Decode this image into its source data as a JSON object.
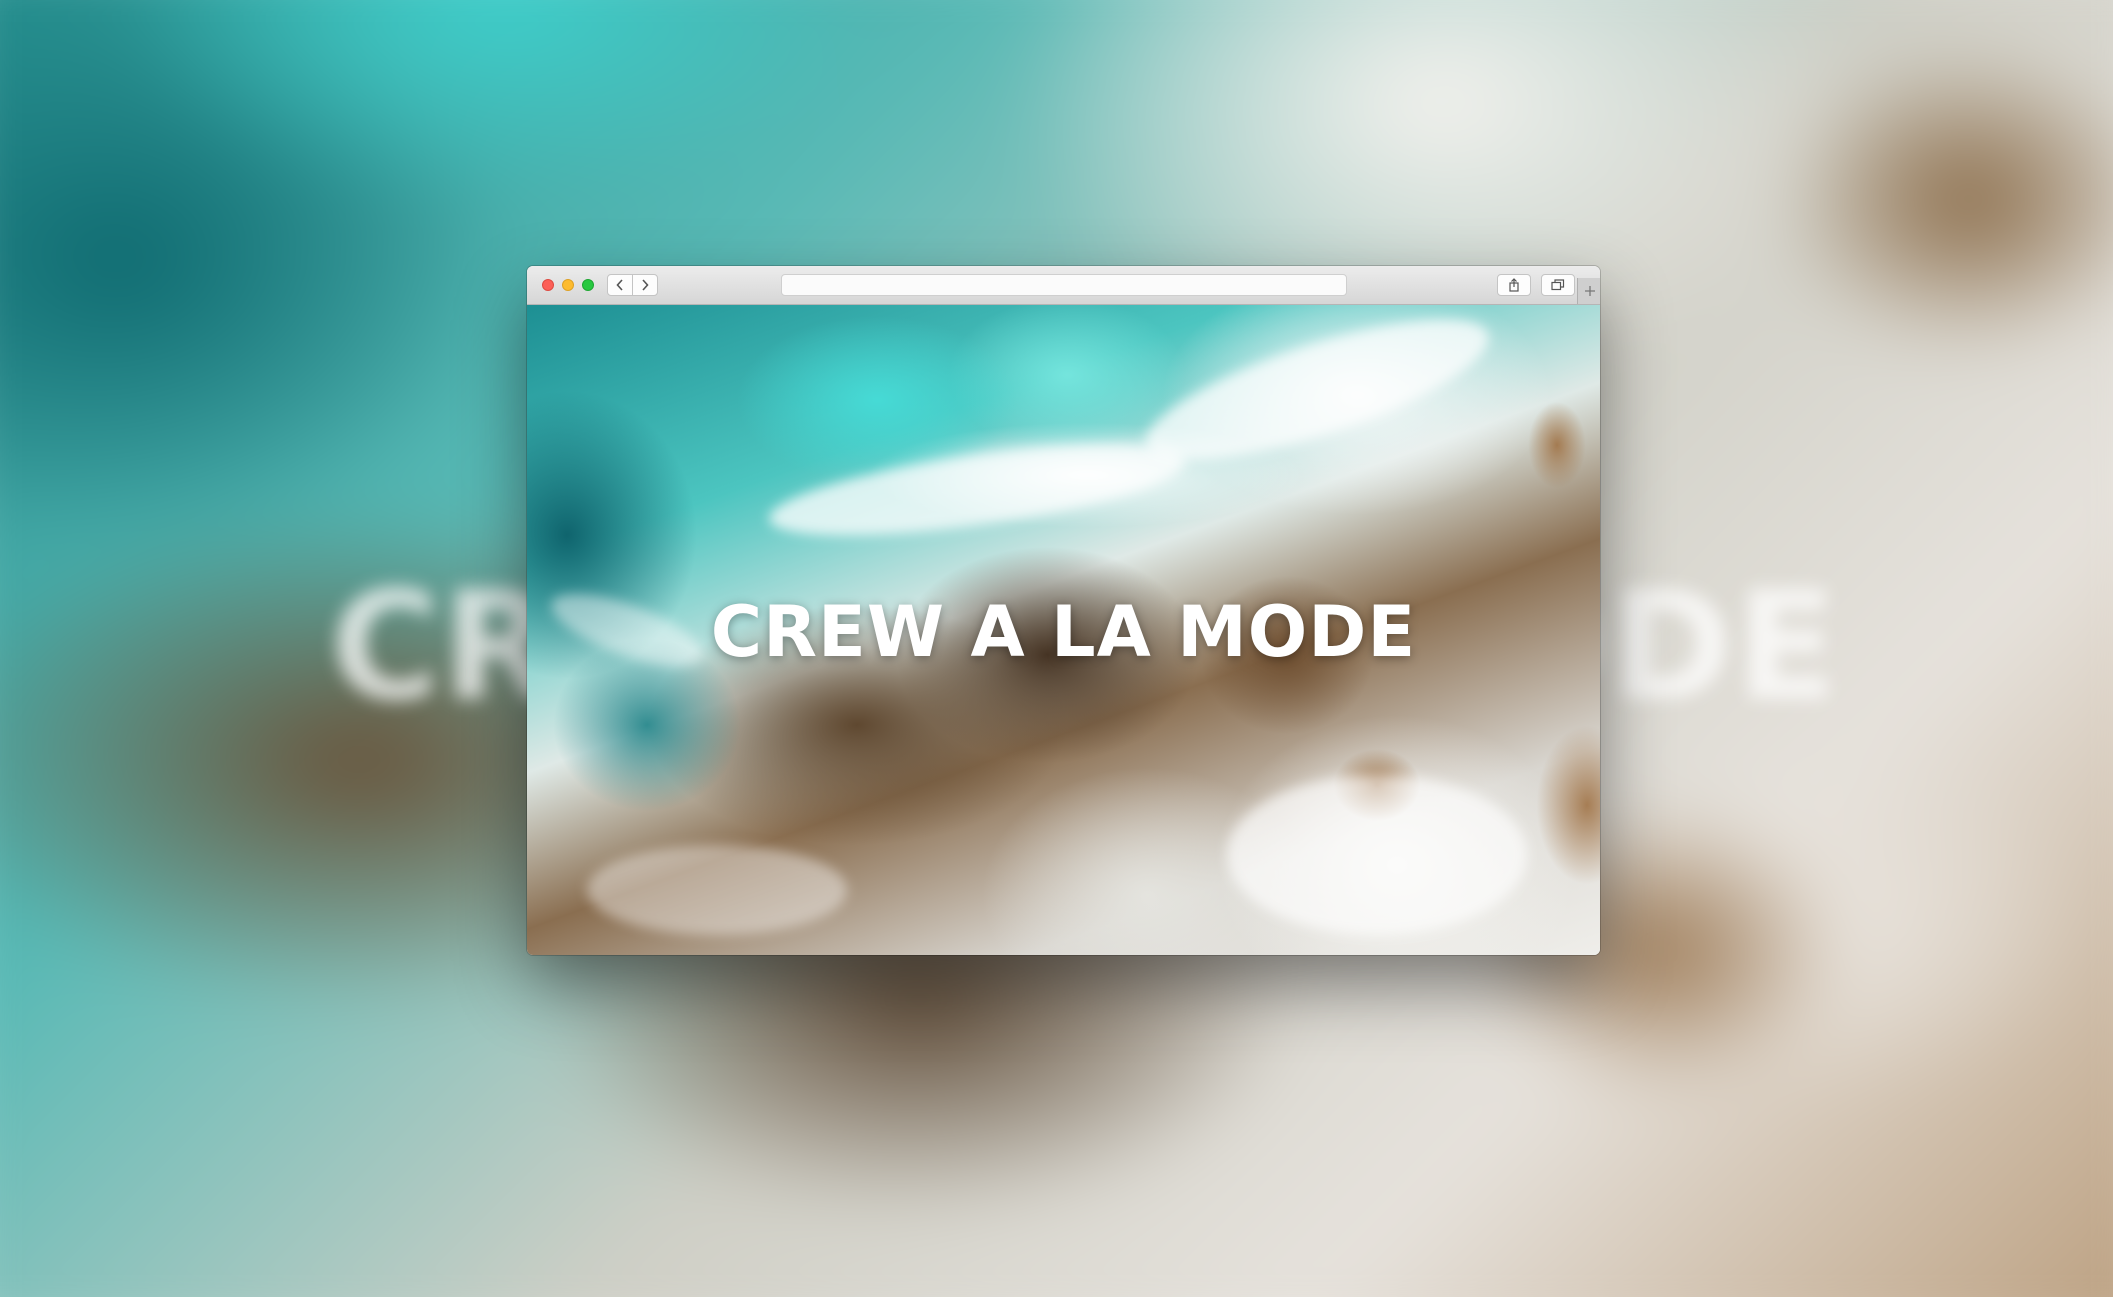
{
  "backdrop": {
    "title": "CREW A LA MODE"
  },
  "browser": {
    "address_bar": {
      "value": ""
    },
    "buttons": {
      "back_icon": "chevron-left-icon",
      "forward_icon": "chevron-right-icon",
      "share_icon": "share-icon",
      "tabs_icon": "tab-overview-icon",
      "new_tab_icon": "plus-icon"
    }
  },
  "page": {
    "hero_title": "CREW A LA MODE"
  },
  "colors": {
    "close": "#fc5f57",
    "minimize": "#fdbb2e",
    "maximize": "#28c840",
    "hero_text": "#ffffff"
  }
}
